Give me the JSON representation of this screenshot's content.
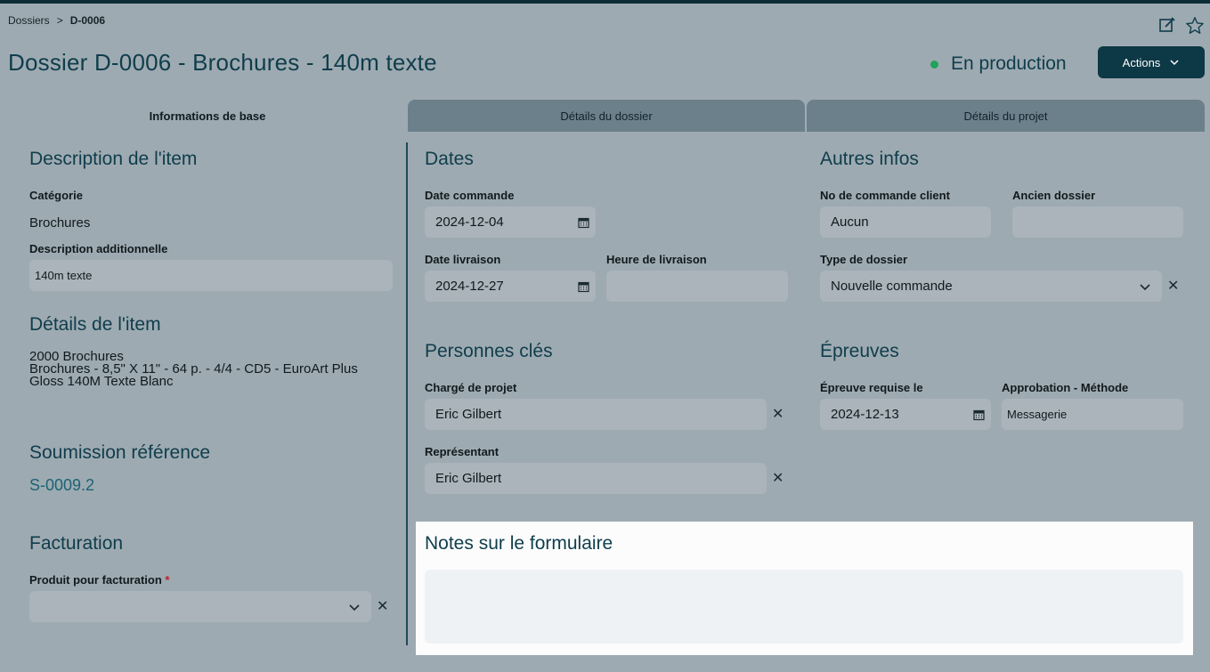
{
  "breadcrumb": {
    "root": "Dossiers",
    "sep": ">",
    "current": "D-0006"
  },
  "header": {
    "title": "Dossier D-0006 - Brochures - 140m texte",
    "status": "En production",
    "status_color": "#1fa25a",
    "actions_label": "Actions",
    "icons": [
      "edit-icon",
      "star-icon"
    ]
  },
  "tabs": [
    {
      "label": "Informations de base",
      "active": true
    },
    {
      "label": "Détails du dossier",
      "active": false
    },
    {
      "label": "Détails du projet",
      "active": false
    }
  ],
  "item": {
    "heading": "Description de l'item",
    "category_label": "Catégorie",
    "category_value": "Brochures",
    "desc_label": "Description additionnelle",
    "desc_value": "140m texte"
  },
  "details": {
    "heading": "Détails de l'item",
    "line1": "2000 Brochures",
    "line2": "Brochures - 8,5\" X 11\" - 64 p. - 4/4 - CD5 - EuroArt Plus Gloss 140M Texte Blanc"
  },
  "submission": {
    "heading": "Soumission référence",
    "link": "S-0009.2"
  },
  "billing": {
    "heading": "Facturation",
    "product_label": "Produit pour facturation",
    "required_mark": "*",
    "product_value": ""
  },
  "dates": {
    "heading": "Dates",
    "order_label": "Date commande",
    "order_value": "2024-12-04",
    "delivery_label": "Date livraison",
    "delivery_value": "2024-12-27",
    "time_label": "Heure de livraison",
    "time_value": ""
  },
  "people": {
    "heading": "Personnes clés",
    "pm_label": "Chargé de projet",
    "pm_value": "Eric Gilbert",
    "rep_label": "Représentant",
    "rep_value": "Eric Gilbert"
  },
  "other": {
    "heading": "Autres infos",
    "po_label": "No de commande client",
    "po_value": "Aucun",
    "old_label": "Ancien dossier",
    "old_value": "",
    "type_label": "Type de dossier",
    "type_value": "Nouvelle commande"
  },
  "proofs": {
    "heading": "Épreuves",
    "required_label": "Épreuve requise le",
    "required_value": "2024-12-13",
    "method_label": "Approbation - Méthode",
    "method_value": "Messagerie"
  },
  "notes": {
    "heading": "Notes sur le formulaire",
    "value": ""
  },
  "clear_glyph": "✕"
}
